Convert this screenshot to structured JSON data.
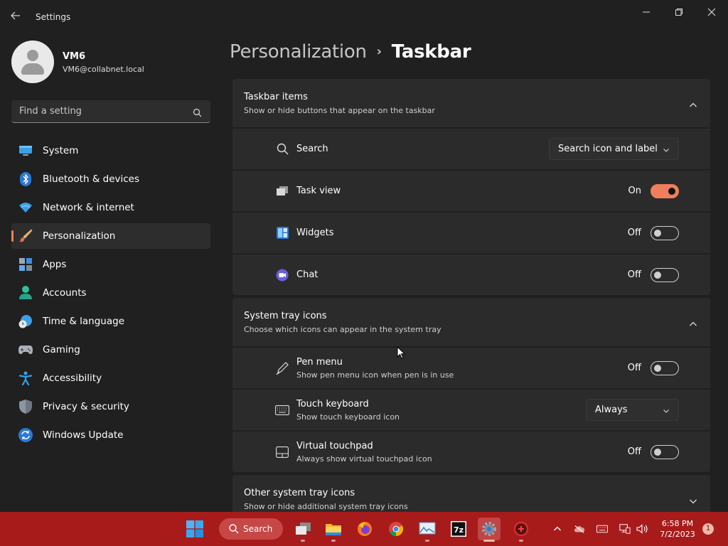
{
  "window": {
    "app_title": "Settings",
    "controls": [
      "minimize",
      "restore",
      "close"
    ]
  },
  "profile": {
    "name": "VM6",
    "email": "VM6@collabnet.local"
  },
  "search": {
    "placeholder": "Find a setting"
  },
  "sidebar": {
    "items": [
      {
        "label": "System",
        "icon": "monitor-icon",
        "active": false
      },
      {
        "label": "Bluetooth & devices",
        "icon": "bluetooth-icon",
        "active": false
      },
      {
        "label": "Network & internet",
        "icon": "wifi-icon",
        "active": false
      },
      {
        "label": "Personalization",
        "icon": "paintbrush-icon",
        "active": true
      },
      {
        "label": "Apps",
        "icon": "apps-icon",
        "active": false
      },
      {
        "label": "Accounts",
        "icon": "person-icon",
        "active": false
      },
      {
        "label": "Time & language",
        "icon": "globe-clock-icon",
        "active": false
      },
      {
        "label": "Gaming",
        "icon": "gamepad-icon",
        "active": false
      },
      {
        "label": "Accessibility",
        "icon": "accessibility-icon",
        "active": false
      },
      {
        "label": "Privacy & security",
        "icon": "shield-icon",
        "active": false
      },
      {
        "label": "Windows Update",
        "icon": "sync-icon",
        "active": false
      }
    ]
  },
  "breadcrumb": {
    "parent": "Personalization",
    "separator": "›",
    "current": "Taskbar"
  },
  "taskbar_items": {
    "title": "Taskbar items",
    "subtitle": "Show or hide buttons that appear on the taskbar",
    "expanded": true,
    "rows": [
      {
        "label": "Search",
        "control": "dropdown",
        "value": "Search icon and label",
        "icon": "search-icon"
      },
      {
        "label": "Task view",
        "control": "toggle",
        "state": "On",
        "on": true,
        "icon": "task-view-icon"
      },
      {
        "label": "Widgets",
        "control": "toggle",
        "state": "Off",
        "on": false,
        "icon": "widgets-icon"
      },
      {
        "label": "Chat",
        "control": "toggle",
        "state": "Off",
        "on": false,
        "icon": "chat-icon"
      }
    ]
  },
  "system_tray": {
    "title": "System tray icons",
    "subtitle": "Choose which icons can appear in the system tray",
    "expanded": true,
    "rows": [
      {
        "label": "Pen menu",
        "sub": "Show pen menu icon when pen is in use",
        "control": "toggle",
        "state": "Off",
        "on": false,
        "icon": "pen-icon"
      },
      {
        "label": "Touch keyboard",
        "sub": "Show touch keyboard icon",
        "control": "dropdown",
        "value": "Always",
        "icon": "keyboard-icon"
      },
      {
        "label": "Virtual touchpad",
        "sub": "Always show virtual touchpad icon",
        "control": "toggle",
        "state": "Off",
        "on": false,
        "icon": "touchpad-icon"
      }
    ]
  },
  "other_tray": {
    "title": "Other system tray icons",
    "subtitle": "Show or hide additional system tray icons",
    "expanded": false
  },
  "taskbar": {
    "search_label": "Search",
    "time": "6:58 PM",
    "date": "7/2/2023",
    "notification_count": "1",
    "colors": {
      "background": "#a81b1b",
      "accent": "#ef7f5c"
    },
    "apps": [
      "task-view-icon",
      "file-explorer-icon",
      "firefox-icon",
      "chrome-icon",
      "image-viewer-icon",
      "7zip-icon",
      "settings-icon",
      "app-icon"
    ],
    "tray": [
      "chevron-up-icon",
      "onedrive-icon",
      "keyboard-icon",
      "network-icon",
      "volume-icon"
    ]
  }
}
